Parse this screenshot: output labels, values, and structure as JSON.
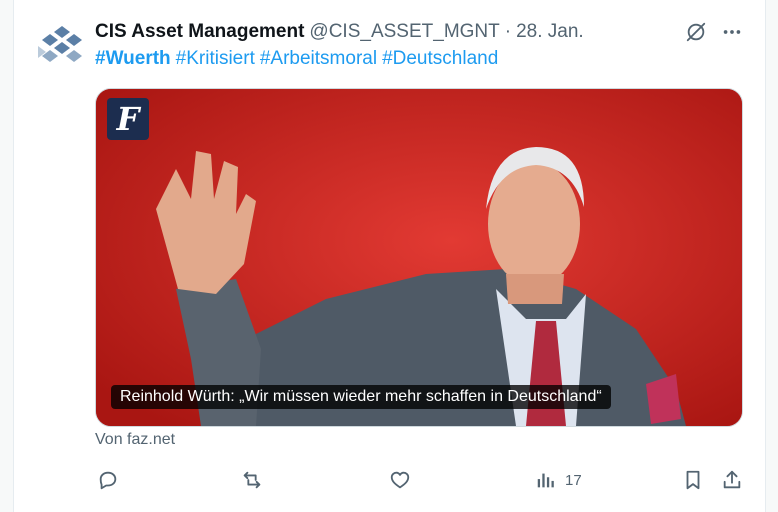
{
  "post": {
    "author_name": "CIS Asset Management",
    "author_handle": "@CIS_ASSET_MGNT",
    "separator": "·",
    "date": "28. Jan.",
    "hashtags": [
      "#Wuerth",
      "#Kritisiert",
      "#Arbeitsmoral",
      "#Deutschland"
    ],
    "media": {
      "logo_letter": "F",
      "caption": "Reinhold Würth: „Wir müssen wieder mehr schaffen in Deutschland“"
    },
    "source": "Von faz.net",
    "views": "17"
  },
  "icons": {
    "avatar": "cis-logo-icon",
    "grok": "grok-icon",
    "more": "more-icon",
    "reply": "reply-icon",
    "repost": "repost-icon",
    "like": "like-icon",
    "views": "views-icon",
    "bookmark": "bookmark-icon",
    "share": "share-icon"
  },
  "colors": {
    "link": "#1d9bf0",
    "text": "#0f1419",
    "muted": "#536471",
    "photo_background": "#c8241f"
  }
}
